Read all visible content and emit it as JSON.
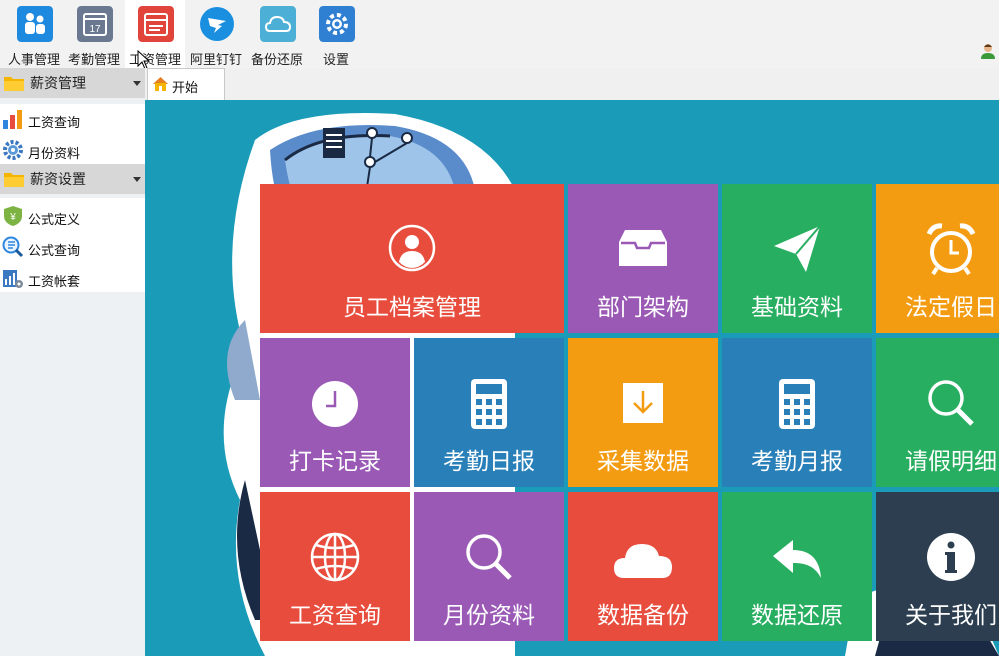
{
  "toolbar": {
    "items": [
      {
        "label": "人事管理",
        "color": "#1d8ae0"
      },
      {
        "label": "考勤管理",
        "color": "#6a7890"
      },
      {
        "label": "工资管理",
        "color": "#e0443a"
      },
      {
        "label": "阿里钉钉",
        "color": "#1a8fe0"
      },
      {
        "label": "备份还原",
        "color": "#4cb0d6"
      },
      {
        "label": "设置",
        "color": "#2f7fd2"
      }
    ]
  },
  "sidebar": {
    "groups": [
      {
        "label": "薪资管理",
        "items": [
          "工资查询",
          "月份资料"
        ]
      },
      {
        "label": "薪资设置",
        "items": [
          "公式定义",
          "公式查询",
          "工资帐套"
        ]
      }
    ]
  },
  "tabs": [
    {
      "label": "开始"
    }
  ],
  "tiles": [
    {
      "label": "员工档案管理",
      "icon": "user-icon",
      "color": "#e74c3c"
    },
    {
      "label": "部门架构",
      "icon": "inbox-icon",
      "color": "#9b59b6"
    },
    {
      "label": "基础资料",
      "icon": "paper-plane-icon",
      "color": "#27ae60"
    },
    {
      "label": "法定假日",
      "icon": "alarm-clock-icon",
      "color": "#f39c12"
    },
    {
      "label": "打卡记录",
      "icon": "clock-icon",
      "color": "#9b59b6"
    },
    {
      "label": "考勤日报",
      "icon": "calculator-icon",
      "color": "#2980b9"
    },
    {
      "label": "采集数据",
      "icon": "download-icon",
      "color": "#f39c12"
    },
    {
      "label": "考勤月报",
      "icon": "calculator-icon",
      "color": "#2980b9"
    },
    {
      "label": "请假明细",
      "icon": "search-icon",
      "color": "#27ae60"
    },
    {
      "label": "工资查询",
      "icon": "globe-icon",
      "color": "#e74c3c"
    },
    {
      "label": "月份资料",
      "icon": "search-icon",
      "color": "#9b59b6"
    },
    {
      "label": "数据备份",
      "icon": "cloud-icon",
      "color": "#e74c3c"
    },
    {
      "label": "数据还原",
      "icon": "reply-icon",
      "color": "#27ae60"
    },
    {
      "label": "关于我们",
      "icon": "info-icon",
      "color": "#2c3e50"
    }
  ]
}
